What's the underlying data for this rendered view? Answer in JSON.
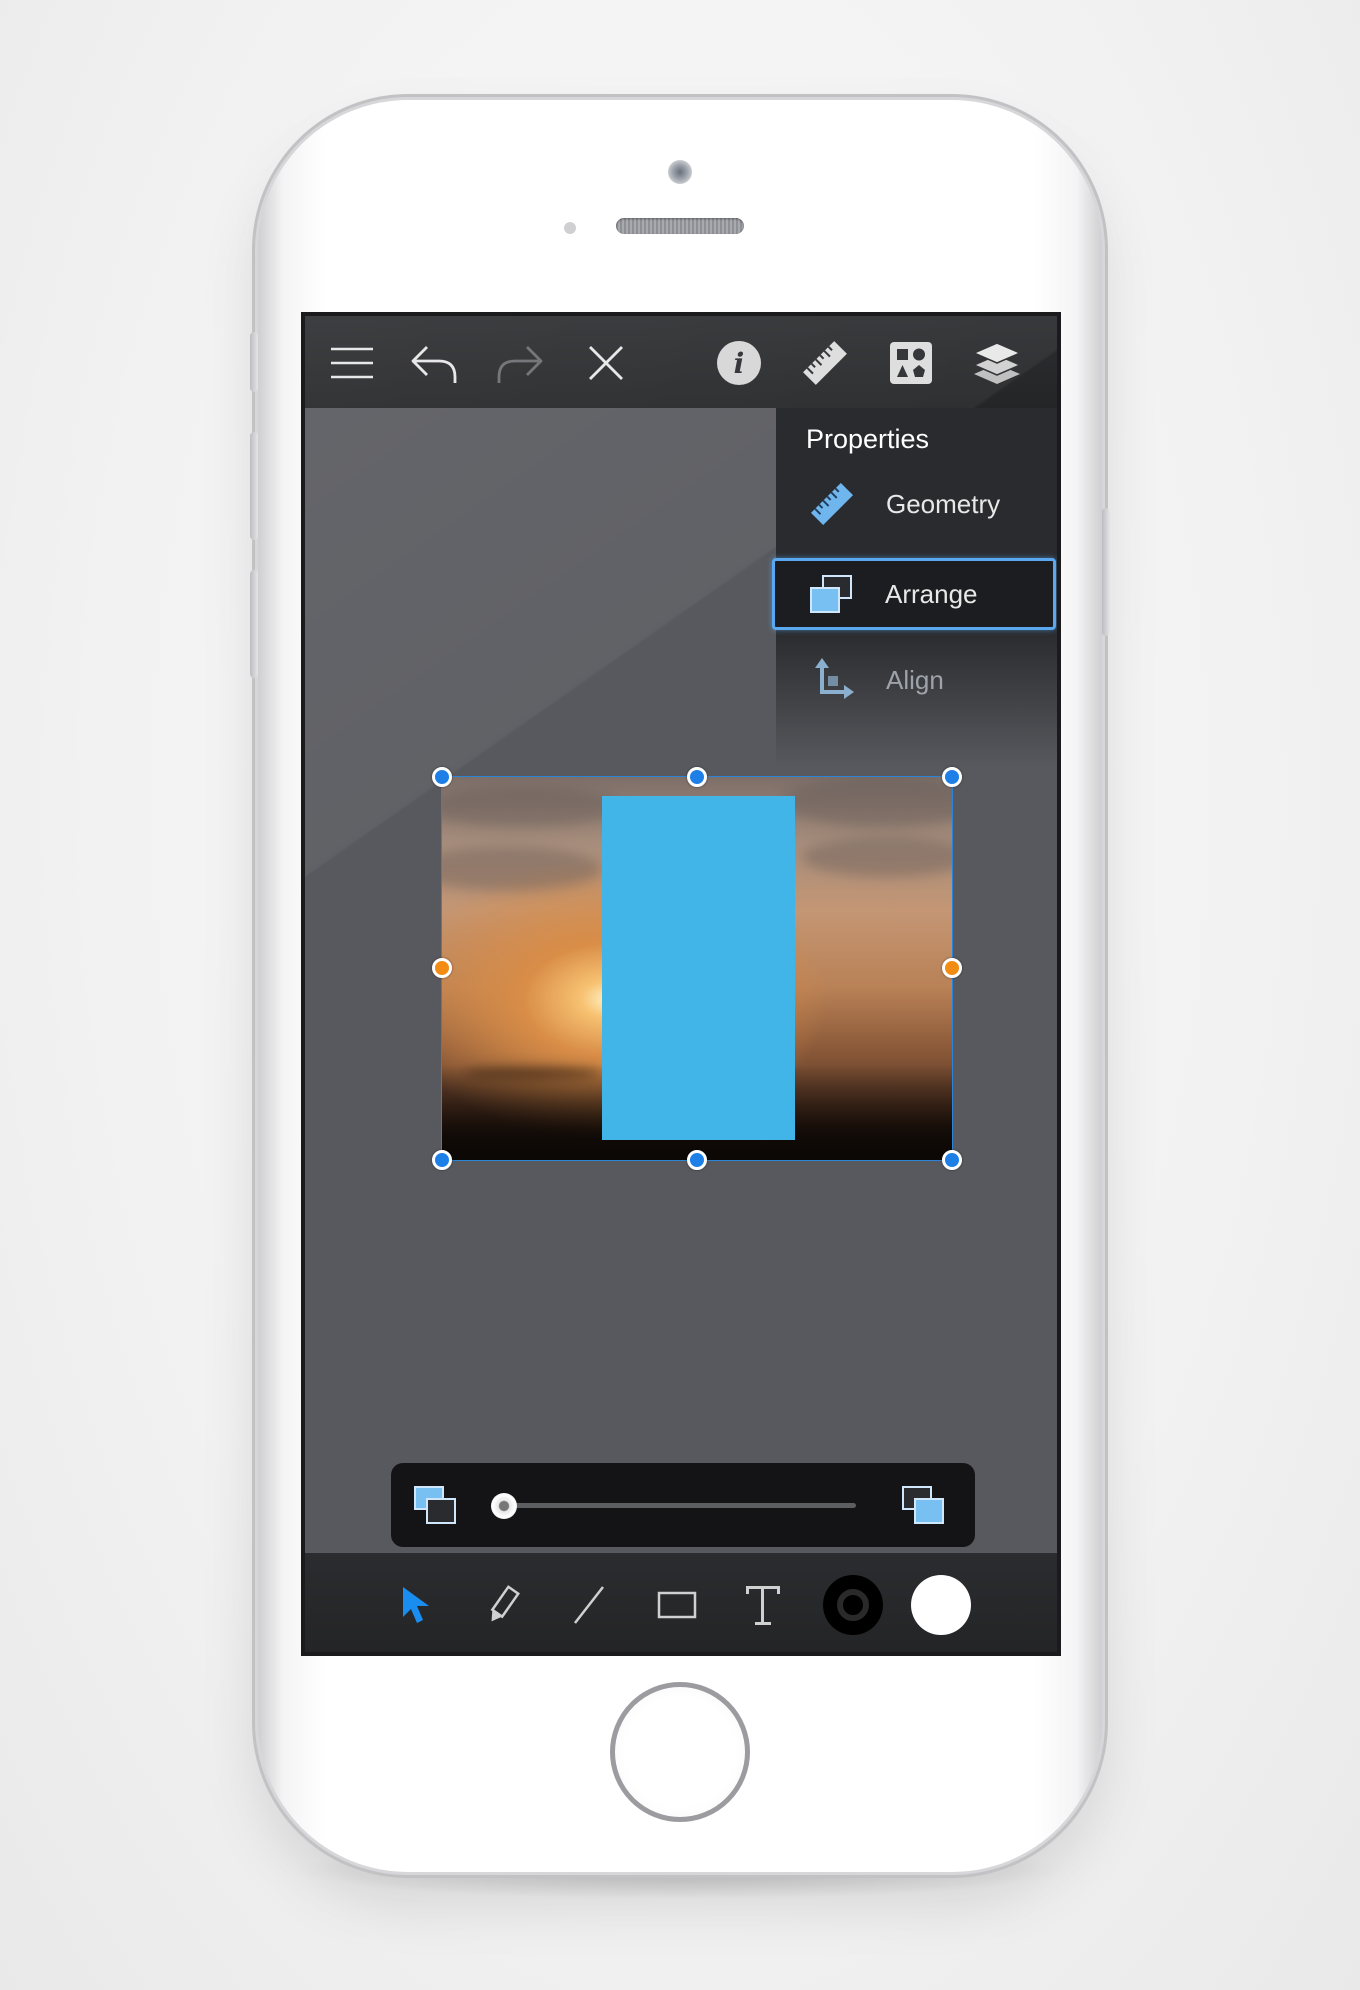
{
  "device": "iphone-white",
  "toolbar": {
    "icons": [
      "menu-icon",
      "undo-icon",
      "redo-icon",
      "close-icon",
      "info-icon",
      "ruler-icon",
      "shapes-library-icon",
      "layers-icon"
    ]
  },
  "properties_panel": {
    "title": "Properties",
    "items": [
      {
        "label": "Geometry",
        "icon": "ruler-icon",
        "selected": false
      },
      {
        "label": "Arrange",
        "icon": "arrange-icon",
        "selected": true
      },
      {
        "label": "Align",
        "icon": "align-icon",
        "selected": false
      }
    ]
  },
  "canvas": {
    "image": "sunset-photo",
    "overlay_shape_color": "#41b5e8",
    "selection_color": "#1e7fe6",
    "rotation_handle_color": "#f28c13"
  },
  "arrange_slider": {
    "left_icon": "send-backward-icon",
    "right_icon": "bring-forward-icon",
    "value": 0
  },
  "bottom_toolbar": {
    "tools": [
      "select-tool",
      "pencil-tool",
      "line-tool",
      "rectangle-tool",
      "text-tool",
      "stroke-color",
      "fill-color"
    ],
    "active_tool": "select-tool",
    "accent": "#1a8ef0"
  }
}
